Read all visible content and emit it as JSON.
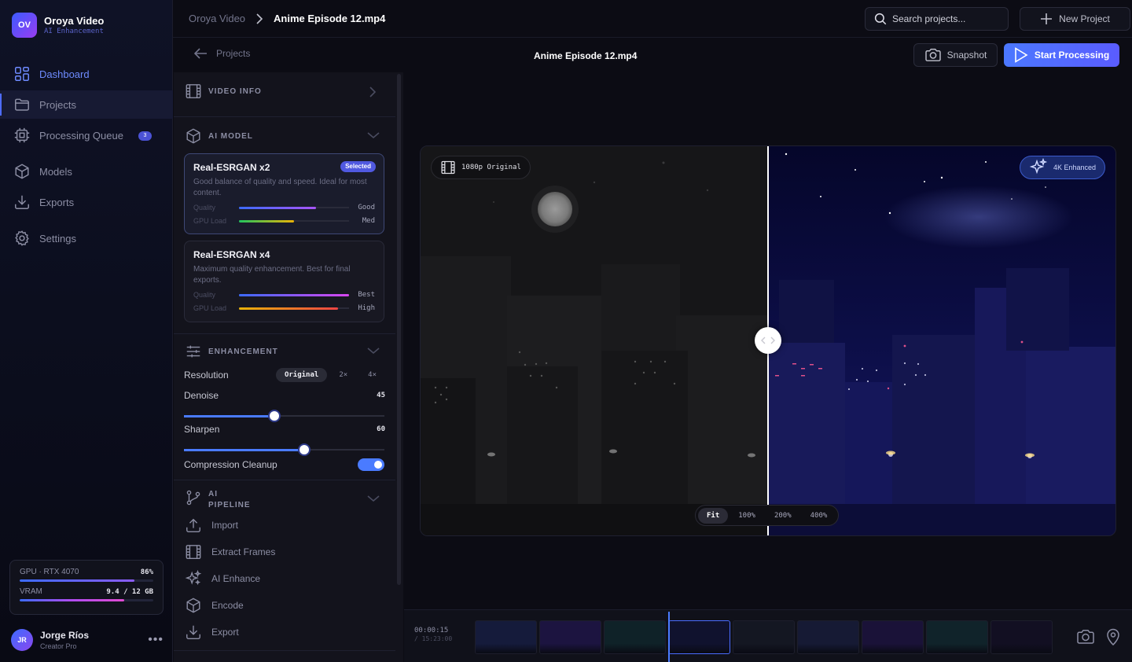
{
  "app": {
    "logo_mark": "OV",
    "name": "Oroya Video",
    "subtitle": "AI Enhancement"
  },
  "nav": {
    "items": [
      {
        "label": "Dashboard",
        "icon": "grid-icon",
        "state": "active"
      },
      {
        "label": "Projects",
        "icon": "folder-icon",
        "state": "selected"
      },
      {
        "label": "Processing Queue",
        "icon": "chip-icon",
        "badge": "3"
      },
      {
        "label": "Models",
        "icon": "cube-icon"
      },
      {
        "label": "Exports",
        "icon": "download-icon"
      },
      {
        "label": "Settings",
        "icon": "gear-icon"
      }
    ]
  },
  "gpu": {
    "label": "GPU · RTX 4070",
    "usage_text": "86%",
    "usage": 0.86,
    "vram_label": "VRAM",
    "vram_text": "9.4 / 12 GB",
    "vram": 0.78
  },
  "user": {
    "initials": "JR",
    "name": "Jorge Ríos",
    "role": "Creator Pro"
  },
  "topbar": {
    "breadcrumb": [
      "Oroya Video",
      "Anime Episode 12.mp4"
    ],
    "search_placeholder": "Search projects...",
    "new_project": "New Project"
  },
  "subheader": {
    "back": "Projects",
    "title": "Anime Episode 12.mp4",
    "snapshot": "Snapshot",
    "start": "Start Processing"
  },
  "panel": {
    "video_info": "VIDEO INFO",
    "ai_model": "AI MODEL",
    "models": [
      {
        "name": "Real-ESRGAN x2",
        "badge": "Selected",
        "desc": "Good balance of quality and speed. Ideal for most content.",
        "quality_label": "Quality",
        "quality": 0.7,
        "quality_text": "Good",
        "gpu_label": "GPU Load",
        "gpu": 0.5,
        "gpu_text": "Med"
      },
      {
        "name": "Real-ESRGAN x4",
        "desc": "Maximum quality enhancement. Best for final exports.",
        "quality_label": "Quality",
        "quality": 1.0,
        "quality_text": "Best",
        "gpu_label": "GPU Load",
        "gpu": 0.9,
        "gpu_text": "High"
      }
    ],
    "enhancement": "ENHANCEMENT",
    "resolution_label": "Resolution",
    "resolution_options": [
      "Original",
      "2×",
      "4×"
    ],
    "denoise_label": "Denoise",
    "denoise": 45,
    "sharpen_label": "Sharpen",
    "sharpen": 60,
    "compression_label": "Compression Cleanup",
    "compression_on": true,
    "pipeline_title_1": "AI",
    "pipeline_title_2": "PIPELINE",
    "pipeline": [
      "Import",
      "Extract Frames",
      "AI Enhance",
      "Encode",
      "Export"
    ]
  },
  "preview": {
    "left_label": "1080p Original",
    "right_label": "4K Enhanced",
    "zoom": [
      "Fit",
      "100%",
      "200%",
      "400%"
    ],
    "zoom_selected": "Fit",
    "split": 0.5
  },
  "timeline": {
    "current": "00:00:15",
    "total": "/ 15:23:00",
    "thumb_colors": [
      "#151b3b",
      "#1c1440",
      "#0f2228",
      "#10122e",
      "#141722",
      "#161a34",
      "#1a1238",
      "#10232a",
      "#120f22"
    ]
  },
  "colors": {
    "accent": "#4a7bff",
    "brand_gradient_start": "#3b5bff",
    "brand_gradient_end": "#9a3cf0"
  }
}
